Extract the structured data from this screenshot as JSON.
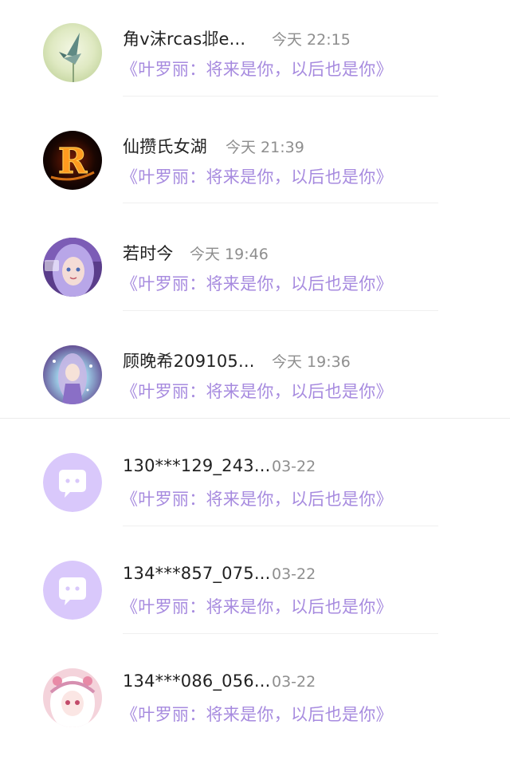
{
  "colors": {
    "message_purple": "#a78bdf",
    "placeholder_avatar_purple": "#d9c8fb",
    "name_text": "#222222",
    "time_text": "#8e8e8e"
  },
  "comments": [
    {
      "name": "角v沫rcas邶e...",
      "time": "今天 22:15",
      "message": "《叶罗丽：将来是你，以后也是你》",
      "avatar": "paper-crane-photo"
    },
    {
      "name": "仙攒氏女湖",
      "time": "今天 21:39",
      "message": "《叶罗丽：将来是你，以后也是你》",
      "avatar": "fire-letter-r",
      "avatar_letter": "R"
    },
    {
      "name": "若时今",
      "time": "今天 19:46",
      "message": "《叶罗丽：将来是你，以后也是你》",
      "avatar": "anime-girl-purple"
    },
    {
      "name": "顾晚希209105...",
      "time": "今天 19:36",
      "message": "《叶罗丽：将来是你，以后也是你》",
      "avatar": "anime-girl-sparkle"
    },
    {
      "name": "130***129_243...",
      "time": "03-22",
      "message": "《叶罗丽：将来是你，以后也是你》",
      "avatar": "default-chat-bubble"
    },
    {
      "name": "134***857_075...",
      "time": "03-22",
      "message": "《叶罗丽：将来是你，以后也是你》",
      "avatar": "default-chat-bubble"
    },
    {
      "name": "134***086_056...",
      "time": "03-22",
      "message": "《叶罗丽：将来是你，以后也是你》",
      "avatar": "anime-girl-pink"
    }
  ]
}
